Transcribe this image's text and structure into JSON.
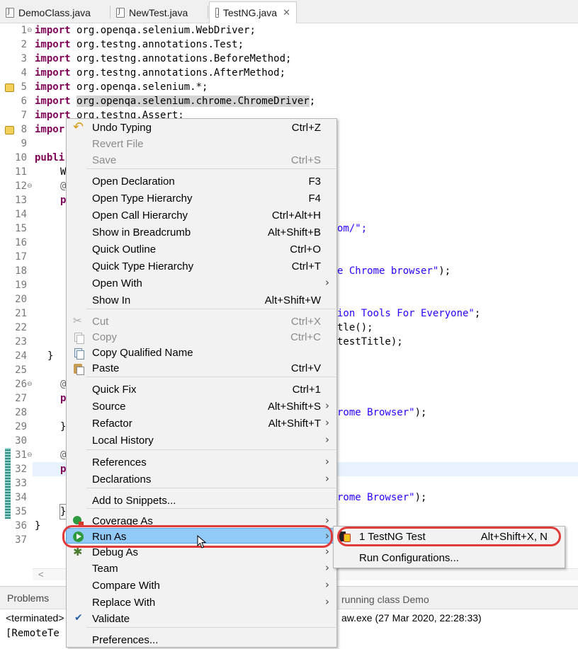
{
  "tabs": [
    {
      "label": "DemoClass.java"
    },
    {
      "label": "NewTest.java"
    },
    {
      "label": "TestNG.java",
      "close": "✕"
    }
  ],
  "code": {
    "line_numbers": [
      "1",
      "2",
      "3",
      "4",
      "5",
      "6",
      "7",
      "8",
      "9",
      "10",
      "11",
      "12",
      "13",
      "14",
      "15",
      "16",
      "17",
      "18",
      "19",
      "20",
      "21",
      "22",
      "23",
      "24",
      "25",
      "26",
      "27",
      "28",
      "29",
      "30",
      "31",
      "32",
      "33",
      "34",
      "35",
      "36",
      "37"
    ],
    "imports": [
      {
        "kw": "import",
        "rest": " org.openqa.selenium.WebDriver;"
      },
      {
        "kw": "import",
        "rest": " org.testng.annotations.Test;"
      },
      {
        "kw": "import",
        "rest": " org.testng.annotations.BeforeMethod;"
      },
      {
        "kw": "import",
        "rest": " org.testng.annotations.AfterMethod;"
      },
      {
        "kw": "import",
        "rest": " org.openqa.selenium.*;"
      },
      {
        "kw": "import",
        "pre": " ",
        "sel": "org.openqa.selenium.chrome.ChromeDriver",
        "post": ";"
      },
      {
        "kw": "import",
        "rest": " org.testng.Assert;"
      },
      {
        "kw": "impor",
        "rest": ""
      }
    ],
    "line10_kw": "publi",
    "line11": "W",
    "line12": "@",
    "line13": "p",
    "line15_tail": "om/\";",
    "line18_str": "e Chrome browser\"",
    "line18_tail": ");",
    "line21_str": "ion Tools For Everyone\"",
    "line21_tail": ";",
    "line22_tail": "tle();",
    "line23_tail": "testTitle);",
    "line24": "}",
    "line26": "@",
    "line27": "p",
    "line28_str": "rome Browser\"",
    "line28_tail": ");",
    "line29": "}",
    "line31": "@",
    "line32": "p",
    "line34_str": "rome Browser\"",
    "line34_tail": ");",
    "line35": "}",
    "line36": "}"
  },
  "menu": {
    "items": [
      {
        "label": "Undo Typing",
        "acc": "Ctrl+Z",
        "icon": "undo-icon"
      },
      {
        "label": "Revert File",
        "acc": "",
        "disabled": true
      },
      {
        "label": "Save",
        "acc": "Ctrl+S",
        "disabled": true
      },
      {
        "label": "Open Declaration",
        "acc": "F3"
      },
      {
        "label": "Open Type Hierarchy",
        "acc": "F4"
      },
      {
        "label": "Open Call Hierarchy",
        "acc": "Ctrl+Alt+H"
      },
      {
        "label": "Show in Breadcrumb",
        "acc": "Alt+Shift+B"
      },
      {
        "label": "Quick Outline",
        "acc": "Ctrl+O"
      },
      {
        "label": "Quick Type Hierarchy",
        "acc": "Ctrl+T"
      },
      {
        "label": "Open With",
        "acc": ""
      },
      {
        "label": "Show In",
        "acc": "Alt+Shift+W"
      },
      {
        "label": "Cut",
        "acc": "Ctrl+X",
        "disabled": true,
        "icon": "cut-icon"
      },
      {
        "label": "Copy",
        "acc": "Ctrl+C",
        "disabled": true,
        "icon": "copy-icon"
      },
      {
        "label": "Copy Qualified Name",
        "acc": "",
        "icon": "copy-qualified-icon"
      },
      {
        "label": "Paste",
        "acc": "Ctrl+V",
        "icon": "paste-icon"
      },
      {
        "label": "Quick Fix",
        "acc": "Ctrl+1"
      },
      {
        "label": "Source",
        "acc": "Alt+Shift+S"
      },
      {
        "label": "Refactor",
        "acc": "Alt+Shift+T"
      },
      {
        "label": "Local History",
        "acc": ""
      },
      {
        "label": "References",
        "acc": ""
      },
      {
        "label": "Declarations",
        "acc": ""
      },
      {
        "label": "Add to Snippets...",
        "acc": ""
      },
      {
        "label": "Coverage As",
        "acc": "",
        "icon": "coverage-icon"
      },
      {
        "label": "Run As",
        "acc": "",
        "icon": "run-icon"
      },
      {
        "label": "Debug As",
        "acc": "",
        "icon": "debug-icon"
      },
      {
        "label": "Team",
        "acc": ""
      },
      {
        "label": "Compare With",
        "acc": ""
      },
      {
        "label": "Replace With",
        "acc": ""
      },
      {
        "label": "Validate",
        "acc": "",
        "icon": "check-icon"
      },
      {
        "label": "Preferences...",
        "acc": ""
      }
    ],
    "submenu_arrow": "›"
  },
  "submenu": {
    "items": [
      {
        "label": "1 TestNG Test",
        "acc": "Alt+Shift+X, N"
      },
      {
        "label": "Run Configurations...",
        "acc": ""
      }
    ]
  },
  "panel": {
    "problems_tab": "Problems",
    "console_title": "running class Demo",
    "terminated": "<terminated>",
    "javaw": "aw.exe (27 Mar 2020, 22:28:33)",
    "remote": "[RemoteTe"
  },
  "colors": {
    "keyword": "#7f0055",
    "string": "#2a00ff",
    "highlight": "#91c9f7",
    "annotation_ring": "#e03a3a"
  }
}
